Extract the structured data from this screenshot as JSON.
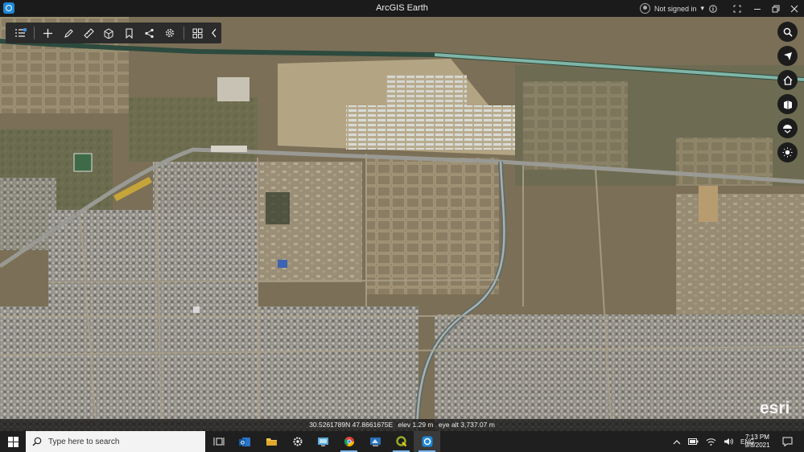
{
  "window": {
    "title": "ArcGIS Earth",
    "user_label": "Not signed in",
    "controls": [
      "info-icon",
      "fullscreen-icon",
      "minimize-icon",
      "restore-icon",
      "close-icon"
    ]
  },
  "toolbar": {
    "tools": [
      "layers-list-icon",
      "add-icon",
      "draw-icon",
      "measure-icon",
      "3d-cube-icon",
      "bookmark-icon",
      "share-icon",
      "settings-icon",
      "apps-grid-icon",
      "collapse-chevron-icon"
    ]
  },
  "nav": {
    "buttons": [
      "search-icon",
      "navigate-icon",
      "home-icon",
      "basemap-icon",
      "tilt-icon",
      "daylight-icon"
    ]
  },
  "status": {
    "coordinates": "30.5261789N 47.8661675E",
    "elevation": "elev 1.29 m",
    "eye_altitude": "eye alt 3,737.07 m"
  },
  "attribution": "esri",
  "taskbar": {
    "search_placeholder": "Type here to search",
    "apps": [
      "task-view-icon",
      "outlook-icon",
      "file-explorer-icon",
      "settings-app-icon",
      "remote-desktop-icon",
      "chrome-icon",
      "app-icon",
      "qgis-icon",
      "arcgis-earth-icon"
    ],
    "tray": {
      "language": "ENG",
      "time": "7:13 PM",
      "date": "9/8/2021"
    }
  },
  "colors": {
    "titlebar": "#1b1b1b",
    "accent": "#1e88d8",
    "road": "#9a9a94",
    "canal": "#7fb5a6"
  }
}
